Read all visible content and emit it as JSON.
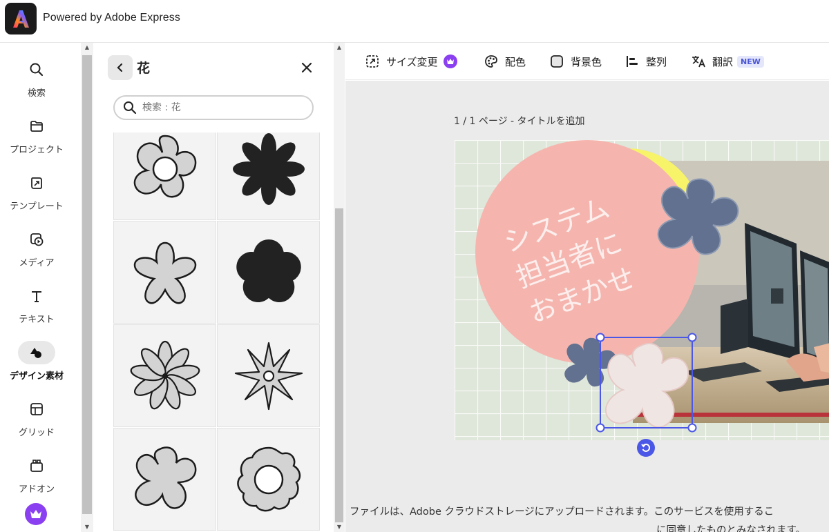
{
  "header": {
    "title": "Powered by Adobe Express",
    "logo_icon": "adobe-express-logo"
  },
  "rail": {
    "items": [
      {
        "label": "検索",
        "icon": "search-icon"
      },
      {
        "label": "プロジェクト",
        "icon": "folder-icon"
      },
      {
        "label": "テンプレート",
        "icon": "template-icon"
      },
      {
        "label": "メディア",
        "icon": "media-icon"
      },
      {
        "label": "テキスト",
        "icon": "text-icon"
      },
      {
        "label": "デザイン素材",
        "icon": "design-elements-icon"
      },
      {
        "label": "グリッド",
        "icon": "grid-icon"
      },
      {
        "label": "アドオン",
        "icon": "addon-icon"
      }
    ],
    "active": "デザイン素材",
    "premium_icon": "crown-icon"
  },
  "panel": {
    "title": "花",
    "search": {
      "placeholder": "検索 : 花",
      "value": ""
    },
    "tiles": [
      {
        "icon": "flower-outline-ring-icon"
      },
      {
        "icon": "flower-black-eight-petal-icon"
      },
      {
        "icon": "flower-outline-star-icon"
      },
      {
        "icon": "flower-black-five-petal-icon"
      },
      {
        "icon": "daisy-outline-icon"
      },
      {
        "icon": "star-flower-outline-icon"
      },
      {
        "icon": "flower-outline-five-petal-icon"
      },
      {
        "icon": "flower-scalloped-ring-icon"
      }
    ]
  },
  "toolbar": {
    "resize": "サイズ変更",
    "color": "配色",
    "background": "背景色",
    "align": "整列",
    "translate": "翻訳",
    "new_badge": "NEW"
  },
  "canvas": {
    "page_label": "1 / 1 ページ - タイトルを追加",
    "headline": [
      "システム",
      "担当者に",
      "おまかせ"
    ],
    "colors": {
      "grid_bg": "#dfe6da",
      "pink": "#f5b5ae",
      "yellow": "#f7f46a",
      "slate": "#62718f",
      "selection": "#4b57e6"
    }
  },
  "footer": {
    "line1": "ファイルは、Adobe クラウドストレージにアップロードされます。このサービスを使用するこ",
    "line2": "に同意したものとみなされます。"
  }
}
